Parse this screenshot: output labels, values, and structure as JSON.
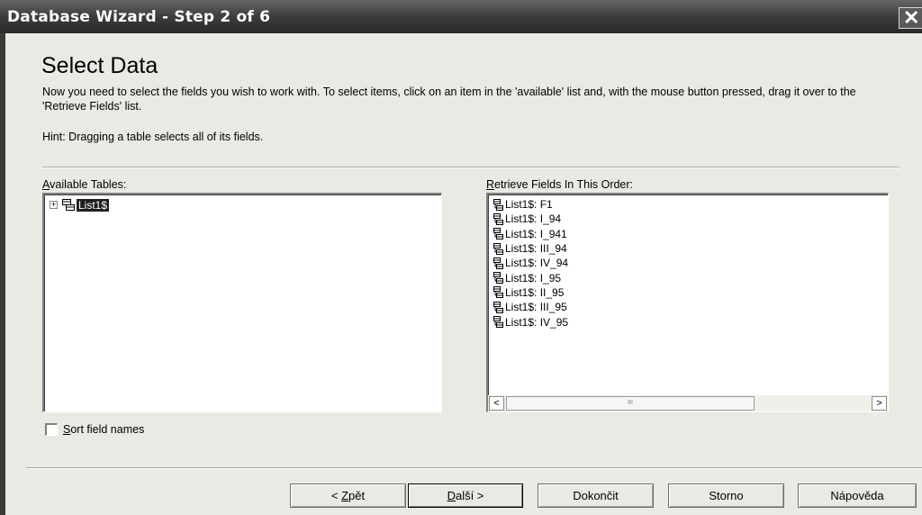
{
  "window": {
    "title": "Database Wizard - Step 2 of 6"
  },
  "page": {
    "heading": "Select Data",
    "description": "Now you need to select the fields you wish to work with. To select items, click on an item in the 'available' list and, with the mouse button pressed, drag it over to the 'Retrieve Fields' list.",
    "hint": "Hint: Dragging a table selects all of its fields."
  },
  "available_tables": {
    "label_mnemonic": "A",
    "label_rest": "vailable Tables:",
    "items": [
      {
        "label": "List1$",
        "expander": "+",
        "selected": true,
        "icon": "table-icon"
      }
    ]
  },
  "retrieve_fields": {
    "label_mnemonic": "R",
    "label_rest": "etrieve Fields In This Order:",
    "items": [
      "List1$: F1",
      "List1$: I_94",
      "List1$: I_941",
      "List1$: III_94",
      "List1$: IV_94",
      "List1$: I_95",
      "List1$: II_95",
      "List1$: III_95",
      "List1$: IV_95"
    ],
    "item_icon": "field-icon",
    "scroll_left": "<",
    "scroll_right": ">",
    "scroll_grip": "III"
  },
  "sort_checkbox": {
    "label_mnemonic": "S",
    "label_rest": "ort field names",
    "checked": false
  },
  "buttons": {
    "back_prefix": "< ",
    "back_mnemonic": "Z",
    "back_rest": "pět",
    "next_mnemonic": "D",
    "next_rest": "alší >",
    "finish": "Dokončit",
    "cancel": "Storno",
    "help": "Nápověda"
  },
  "colors": {
    "titlebar": "#3c3c3c",
    "dialog_bg": "#ebe9e4",
    "selection_bg": "#1f1f1f"
  }
}
